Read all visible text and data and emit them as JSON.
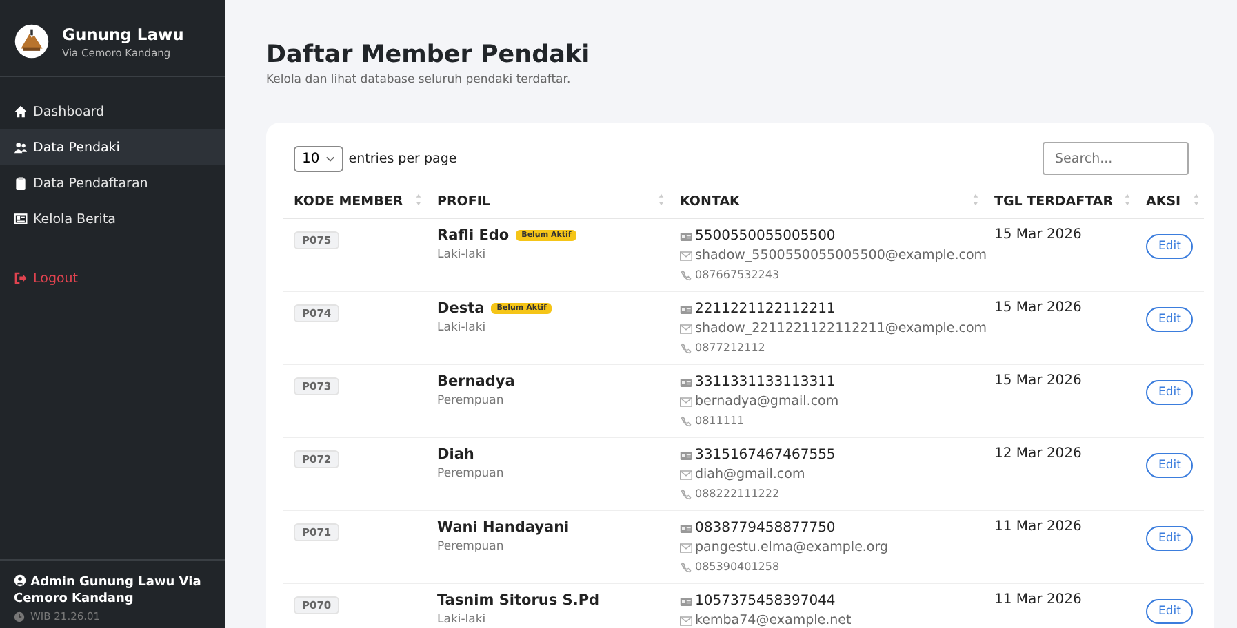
{
  "brand": {
    "title": "Gunung Lawu",
    "subtitle": "Via Cemoro Kandang"
  },
  "nav": [
    {
      "label": "Dashboard",
      "selected": false
    },
    {
      "label": "Data Pendaki",
      "selected": true
    },
    {
      "label": "Data Pendaftaran",
      "selected": false
    },
    {
      "label": "Kelola Berita",
      "selected": false
    }
  ],
  "logout": "Logout",
  "user": {
    "name": "Admin Gunung Lawu Via Cemoro Kandang",
    "time": "WIB 21.26.01"
  },
  "page": {
    "title": "Daftar Member Pendaki",
    "subtitle": "Kelola dan lihat database seluruh pendaki terdaftar."
  },
  "table": {
    "page_size": "10",
    "page_size_label": "entries per page",
    "search": {
      "placeholder": "Search..."
    },
    "columns": [
      "KODE MEMBER",
      "PROFIL",
      "KONTAK",
      "TGL TERDAFTAR",
      "AKSI"
    ],
    "rows": [
      {
        "code": "P075",
        "name": "Rafli Edo",
        "badge": "Belum Aktif",
        "gender": "Laki-laki",
        "nik": "5500550055005500",
        "email": "shadow_5500550055005500@example.com",
        "phone": "087667532243",
        "date": "15 Mar 2026",
        "action": "Edit"
      },
      {
        "code": "P074",
        "name": "Desta",
        "badge": "Belum Aktif",
        "gender": "Laki-laki",
        "nik": "2211221122112211",
        "email": "shadow_2211221122112211@example.com",
        "phone": "0877212112",
        "date": "15 Mar 2026",
        "action": "Edit"
      },
      {
        "code": "P073",
        "name": "Bernadya",
        "gender": "Perempuan",
        "nik": "3311331133113311",
        "email": "bernadya@gmail.com",
        "phone": "0811111",
        "date": "15 Mar 2026",
        "action": "Edit"
      },
      {
        "code": "P072",
        "name": "Diah",
        "gender": "Perempuan",
        "nik": "3315167467467555",
        "email": "diah@gmail.com",
        "phone": "088222111222",
        "date": "12 Mar 2026",
        "action": "Edit"
      },
      {
        "code": "P071",
        "name": "Wani Handayani",
        "gender": "Perempuan",
        "nik": "0838779458877750",
        "email": "pangestu.elma@example.org",
        "phone": "085390401258",
        "date": "11 Mar 2026",
        "action": "Edit"
      },
      {
        "code": "P070",
        "name": "Tasnim Sitorus S.Pd",
        "gender": "Laki-laki",
        "nik": "1057375458397044",
        "email": "kemba74@example.net",
        "date": "11 Mar 2026",
        "action": "Edit"
      }
    ]
  }
}
